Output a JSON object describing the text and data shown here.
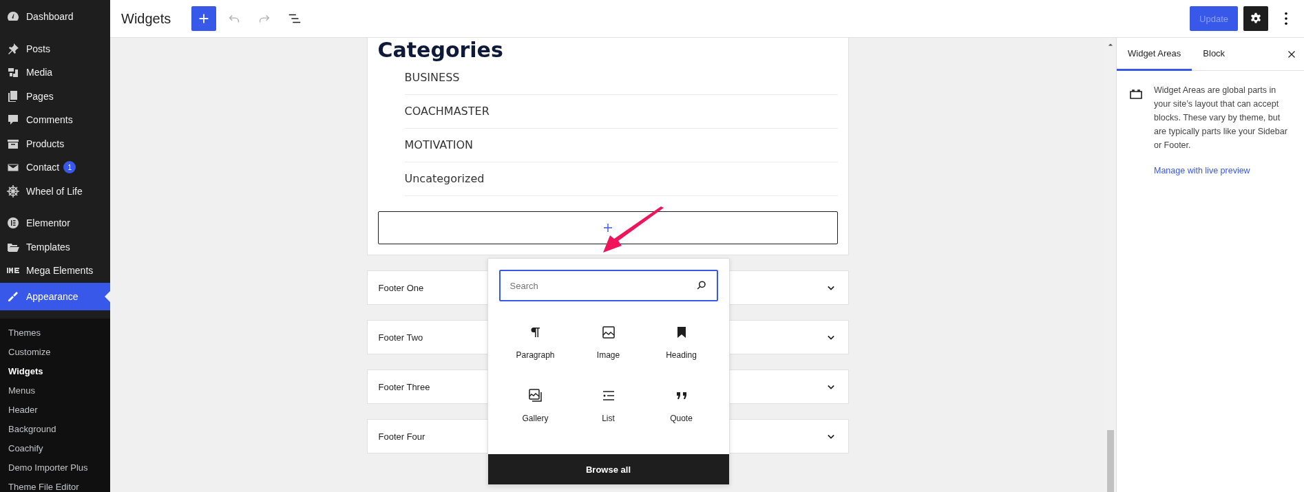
{
  "sidebar": {
    "groups": [
      {
        "items": [
          {
            "label": "Dashboard",
            "selected": false
          }
        ]
      },
      {
        "items": [
          {
            "label": "Posts",
            "selected": false
          },
          {
            "label": "Media",
            "selected": false
          },
          {
            "label": "Pages",
            "selected": false
          },
          {
            "label": "Comments",
            "selected": false
          },
          {
            "label": "Products",
            "selected": false
          },
          {
            "label": "Contact",
            "badge": "1",
            "selected": false
          },
          {
            "label": "Wheel of Life",
            "selected": false
          }
        ]
      },
      {
        "items": [
          {
            "label": "Elementor",
            "selected": false
          },
          {
            "label": "Templates",
            "selected": false
          },
          {
            "label": "Mega Elements",
            "selected": false
          },
          {
            "label": "Appearance",
            "selected": true
          }
        ]
      }
    ],
    "submenu": [
      {
        "label": "Themes",
        "selected": false
      },
      {
        "label": "Customize",
        "selected": false
      },
      {
        "label": "Widgets",
        "selected": true
      },
      {
        "label": "Menus",
        "selected": false
      },
      {
        "label": "Header",
        "selected": false
      },
      {
        "label": "Background",
        "selected": false
      },
      {
        "label": "Coachify",
        "selected": false
      },
      {
        "label": "Demo Importer Plus",
        "selected": false
      },
      {
        "label": "Theme File Editor",
        "selected": false
      }
    ]
  },
  "header": {
    "title": "Widgets",
    "undo_disabled": true,
    "redo_disabled": true,
    "update": {
      "label": "Update",
      "disabled": true
    },
    "settings_pressed": true
  },
  "categories_block": {
    "heading": "Categories",
    "items": [
      "BUSINESS",
      "COACHMASTER",
      "MOTIVATION",
      "Uncategorized"
    ]
  },
  "widget_areas": [
    {
      "label": "Footer One"
    },
    {
      "label": "Footer Two"
    },
    {
      "label": "Footer Three"
    },
    {
      "label": "Footer Four"
    }
  ],
  "inserter": {
    "search": {
      "placeholder": "Search"
    },
    "blocks": [
      {
        "label": "Paragraph"
      },
      {
        "label": "Image"
      },
      {
        "label": "Heading"
      },
      {
        "label": "Gallery"
      },
      {
        "label": "List"
      },
      {
        "label": "Quote"
      }
    ],
    "browse_all": "Browse all"
  },
  "settings_panel": {
    "tabs": [
      {
        "label": "Widget Areas",
        "selected": true
      },
      {
        "label": "Block",
        "selected": false
      }
    ],
    "description": "Widget Areas are global parts in your site’s layout that can accept blocks. These vary by theme, but are typically parts like your Sidebar or Footer.",
    "link": "Manage with live preview"
  }
}
